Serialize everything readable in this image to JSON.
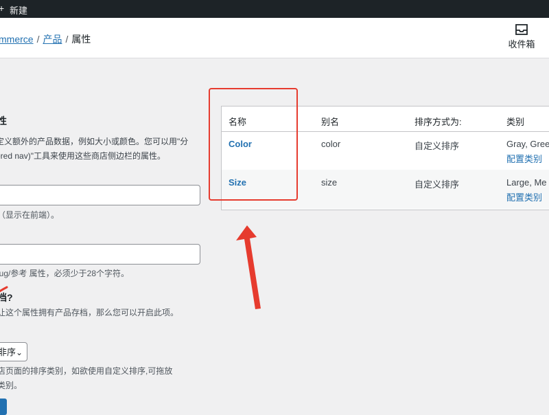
{
  "admin_bar": {
    "new_label": "新建",
    "plus_glyph": "+"
  },
  "breadcrumb": {
    "root": "mmerce",
    "sep1": "/",
    "products": "产品",
    "sep2": "/",
    "current": "属性"
  },
  "inbox": {
    "label": "收件箱",
    "icon": "inbox-icon"
  },
  "form": {
    "title": "性",
    "desc_line1": "定义额外的产品数据，例如大小或颜色。您可以用\"分",
    "desc_line2": "ered nav)\"工具来使用这些商店侧边栏的属性。",
    "name_help": "（显示在前端）。",
    "slug_help": "lug/参考 属性，必须少于28个字符。",
    "archive_label": "档?",
    "archive_help": "让这个属性拥有产品存档，那么您可以开启此项。",
    "sort_value": "非序",
    "sort_help_line1": "店页面的排序类别，如欲使用自定义排序,可拖放",
    "sort_help_line2": "类别。"
  },
  "table": {
    "headers": [
      "名称",
      "别名",
      "排序方式为:",
      "类别"
    ],
    "rows": [
      {
        "name": "Color",
        "slug": "color",
        "order": "自定义排序",
        "terms": "Gray, Gree",
        "configure": "配置类别"
      },
      {
        "name": "Size",
        "slug": "size",
        "order": "自定义排序",
        "terms": "Large, Me",
        "configure": "配置类别"
      }
    ]
  },
  "colors": {
    "link": "#2271b1",
    "annotation": "#e63b2e",
    "adminbar": "#1d2327"
  }
}
